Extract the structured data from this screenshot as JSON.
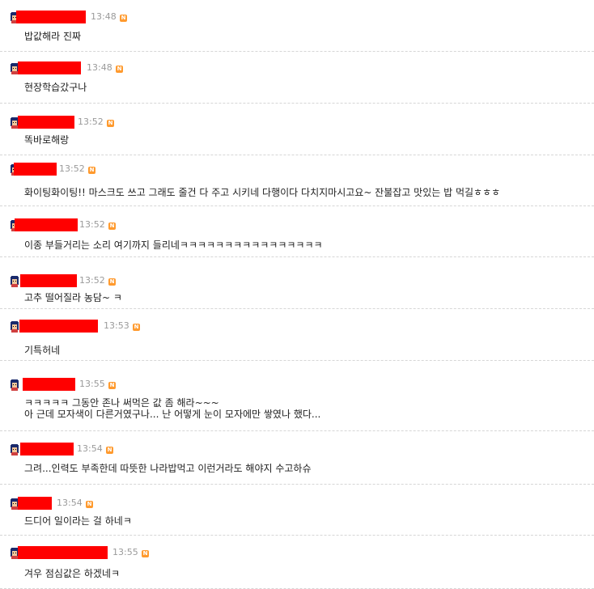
{
  "comments": [
    {
      "time": "13:48",
      "badge": "N",
      "lines": [
        "밥값해라 진짜"
      ],
      "avatar": "avatar-icon"
    },
    {
      "time": "13:48",
      "badge": "N",
      "lines": [
        "현장학습갔구나"
      ],
      "avatar": "avatar-icon"
    },
    {
      "time": "13:52",
      "badge": "N",
      "lines": [
        "똑바로해랑"
      ],
      "avatar": "avatar-icon"
    },
    {
      "time": "13:52",
      "badge": "N",
      "lines": [
        "화이팅화이팅!! 마스크도 쓰고 그래도 줄건 다 주고 시키네 다행이다 다치지마시고요~ 잔불잡고 맛있는 밥 먹길ㅎㅎㅎ"
      ],
      "avatar": "avatar-icon"
    },
    {
      "time": "13:52",
      "badge": "N",
      "lines": [
        "이종 부들거리는 소리 여기까지 들리네ㅋㅋㅋㅋㅋㅋㅋㅋㅋㅋㅋㅋㅋㅋㅋㅋ"
      ],
      "avatar": "avatar-icon"
    },
    {
      "time": "13:52",
      "badge": "N",
      "lines": [
        "고추 떨어질라 농담~ ㅋ"
      ],
      "avatar": "avatar-icon"
    },
    {
      "time": "13:53",
      "badge": "N",
      "lines": [
        "기특허네"
      ],
      "avatar": "avatar-icon"
    },
    {
      "time": "13:55",
      "badge": "N",
      "lines": [
        "ㅋㅋㅋㅋㅋ 그동안 존나 써먹은 값 좀 해라~~~",
        "아 근데 모자색이 다른거였구나... 난 어떻게 눈이 모자에만 쌓였나 했다..."
      ],
      "avatar": "avatar-icon"
    },
    {
      "time": "13:54",
      "badge": "N",
      "lines": [
        "그려...인력도 부족한데 따뜻한 나라밥먹고 이런거라도 해야지 수고하슈"
      ],
      "avatar": "avatar-icon"
    },
    {
      "time": "13:54",
      "badge": "N",
      "lines": [
        "드디어 일이라는 걸 하네ㅋ"
      ],
      "avatar": "avatar-icon"
    },
    {
      "time": "13:55",
      "badge": "N",
      "lines": [
        "겨우 점심값은 하겠네ㅋ"
      ],
      "avatar": "avatar-icon"
    }
  ],
  "colors": {
    "redaction": "#ff0000",
    "badge": "#ff9a2e",
    "separator": "#d6d6d6",
    "time": "#9a9a9a"
  }
}
